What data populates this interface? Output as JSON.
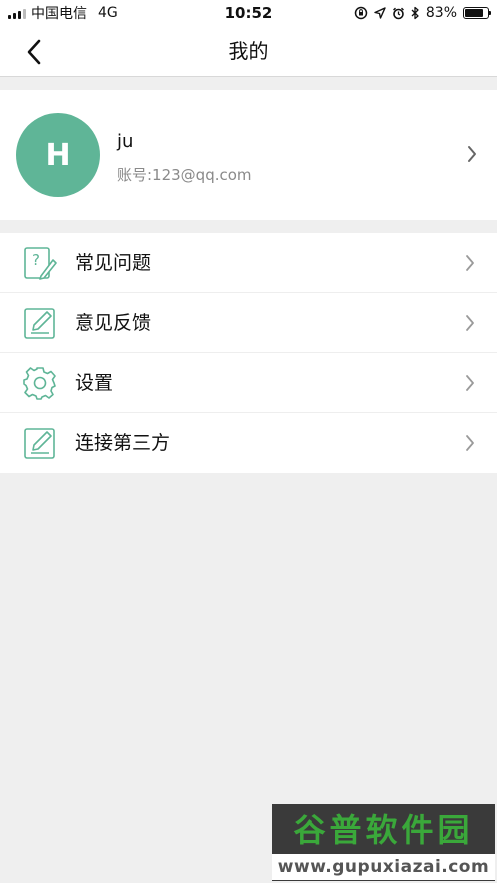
{
  "status_bar": {
    "carrier": "中国电信",
    "network": "4G",
    "time": "10:52",
    "battery_percent": "83%",
    "battery_level": 0.83,
    "icons": [
      "signal-icon",
      "rotation-lock-icon",
      "location-icon",
      "alarm-icon",
      "bluetooth-icon",
      "battery-icon"
    ]
  },
  "nav": {
    "title": "我的",
    "back_icon": "chevron-left-icon"
  },
  "profile": {
    "avatar_letter": "H",
    "name": "ju",
    "account": "账号:123@qq.com"
  },
  "menu": {
    "items": [
      {
        "label": "常见问题",
        "icon": "faq-icon"
      },
      {
        "label": "意见反馈",
        "icon": "feedback-edit-icon"
      },
      {
        "label": "设置",
        "icon": "gear-icon"
      },
      {
        "label": "连接第三方",
        "icon": "edit-icon"
      }
    ]
  },
  "watermark": {
    "title": "谷普软件园",
    "url": "www.gupuxiazai.com"
  },
  "colors": {
    "accent": "#5fb597",
    "icon_stroke": "#5fb597",
    "background": "#efefef",
    "chevron": "#9a9a9a"
  }
}
